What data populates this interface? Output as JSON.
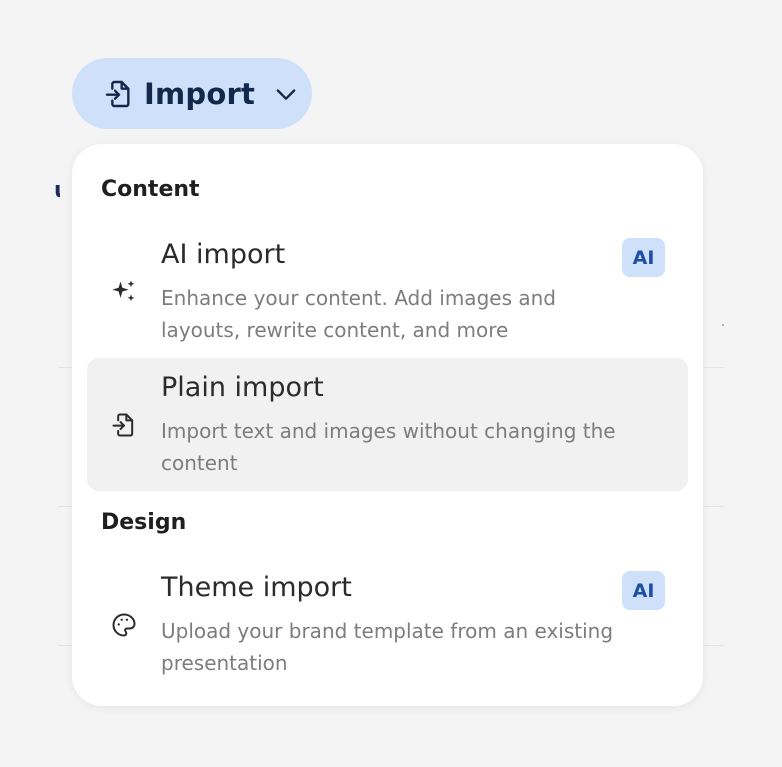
{
  "import_button": {
    "label": "Import",
    "icon": "file-import-icon",
    "chevron": "chevron-down-icon"
  },
  "menu": {
    "sections": [
      {
        "title": "Content",
        "items": [
          {
            "icon": "sparkles-icon",
            "title": "AI import",
            "description": "Enhance your content. Add images and layouts, rewrite content, and more",
            "badge": "AI"
          },
          {
            "icon": "file-import-icon",
            "title": "Plain import",
            "description": "Import text and images without changing the content",
            "state": "hovered"
          }
        ]
      },
      {
        "title": "Design",
        "items": [
          {
            "icon": "palette-icon",
            "title": "Theme import",
            "description": "Upload your brand template from an existing presentation",
            "badge": "AI"
          }
        ]
      }
    ]
  },
  "colors": {
    "accent_bg": "#cfe0fb",
    "accent_text": "#1e4fa3",
    "button_text": "#13294b",
    "hover_bg": "#f1f1f1",
    "page_bg": "#f4f4f4"
  }
}
